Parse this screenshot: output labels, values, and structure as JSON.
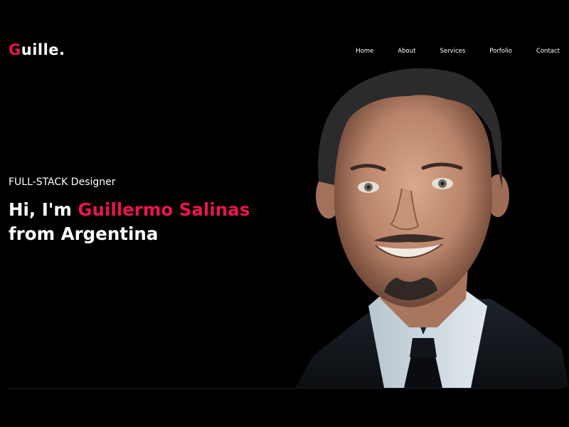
{
  "brand": {
    "logo_first": "G",
    "logo_rest": "uille."
  },
  "nav": {
    "items": [
      {
        "label": "Home"
      },
      {
        "label": "About"
      },
      {
        "label": "Services"
      },
      {
        "label": "Porfolio"
      },
      {
        "label": "Contact"
      }
    ]
  },
  "hero": {
    "eyebrow": "FULL-STACK Designer",
    "greeting": "Hi, I'm ",
    "name": "Guillermo Salinas",
    "line2": "from Argentina"
  },
  "colors": {
    "accent": "#e8154f",
    "background": "#000000",
    "text": "#ffffff"
  },
  "icons": {
    "portrait": "profile-photo"
  }
}
